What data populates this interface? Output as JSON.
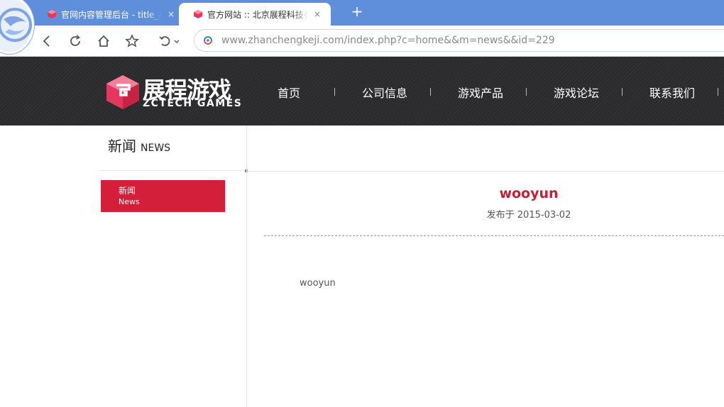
{
  "browser": {
    "tabs": [
      {
        "title": "官网内容管理后台 - title_a",
        "close": "×",
        "active": false
      },
      {
        "title": "官方网站 :: 北京展程科技有",
        "close": "×",
        "active": true
      }
    ],
    "new_tab": "+",
    "address": {
      "host": "www.zhanchengkeji.com",
      "path": "/index.php?c=home&&m=news&&id=229"
    },
    "toolbar_icons": [
      "back-icon",
      "refresh-icon",
      "home-icon",
      "star-icon",
      "undo-icon"
    ]
  },
  "site": {
    "logo": {
      "cn": "展程游戏",
      "en": "ZCTECH GAMES"
    },
    "nav": [
      "首页",
      "公司信息",
      "游戏产品",
      "游戏论坛",
      "联系我们"
    ],
    "sidebar": {
      "title_cn": "新闻",
      "title_en": "NEWS",
      "menu": [
        {
          "cn": "新闻",
          "en": "News"
        }
      ]
    },
    "article": {
      "title": "wooyun",
      "date": "发布于 2015-03-02",
      "body": "wooyun"
    }
  },
  "colors": {
    "tabbar": "#5f8fdb",
    "header": "#2d2d2f",
    "accent_red": "#d41f3a",
    "title_red": "#c41f35"
  }
}
